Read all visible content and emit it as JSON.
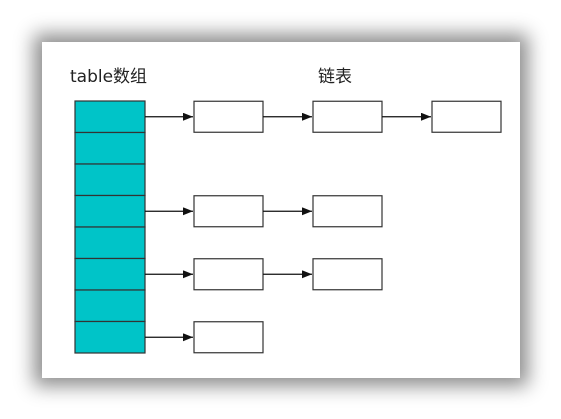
{
  "labels": {
    "array": "table数组",
    "linked_list": "链表"
  },
  "colors": {
    "array_fill": "#00c4c8",
    "stroke": "#333333"
  },
  "array": {
    "cell_count": 8
  },
  "chains": [
    {
      "bucket": 0,
      "nodes": 3
    },
    {
      "bucket": 3,
      "nodes": 2
    },
    {
      "bucket": 5,
      "nodes": 2
    },
    {
      "bucket": 7,
      "nodes": 1
    }
  ]
}
